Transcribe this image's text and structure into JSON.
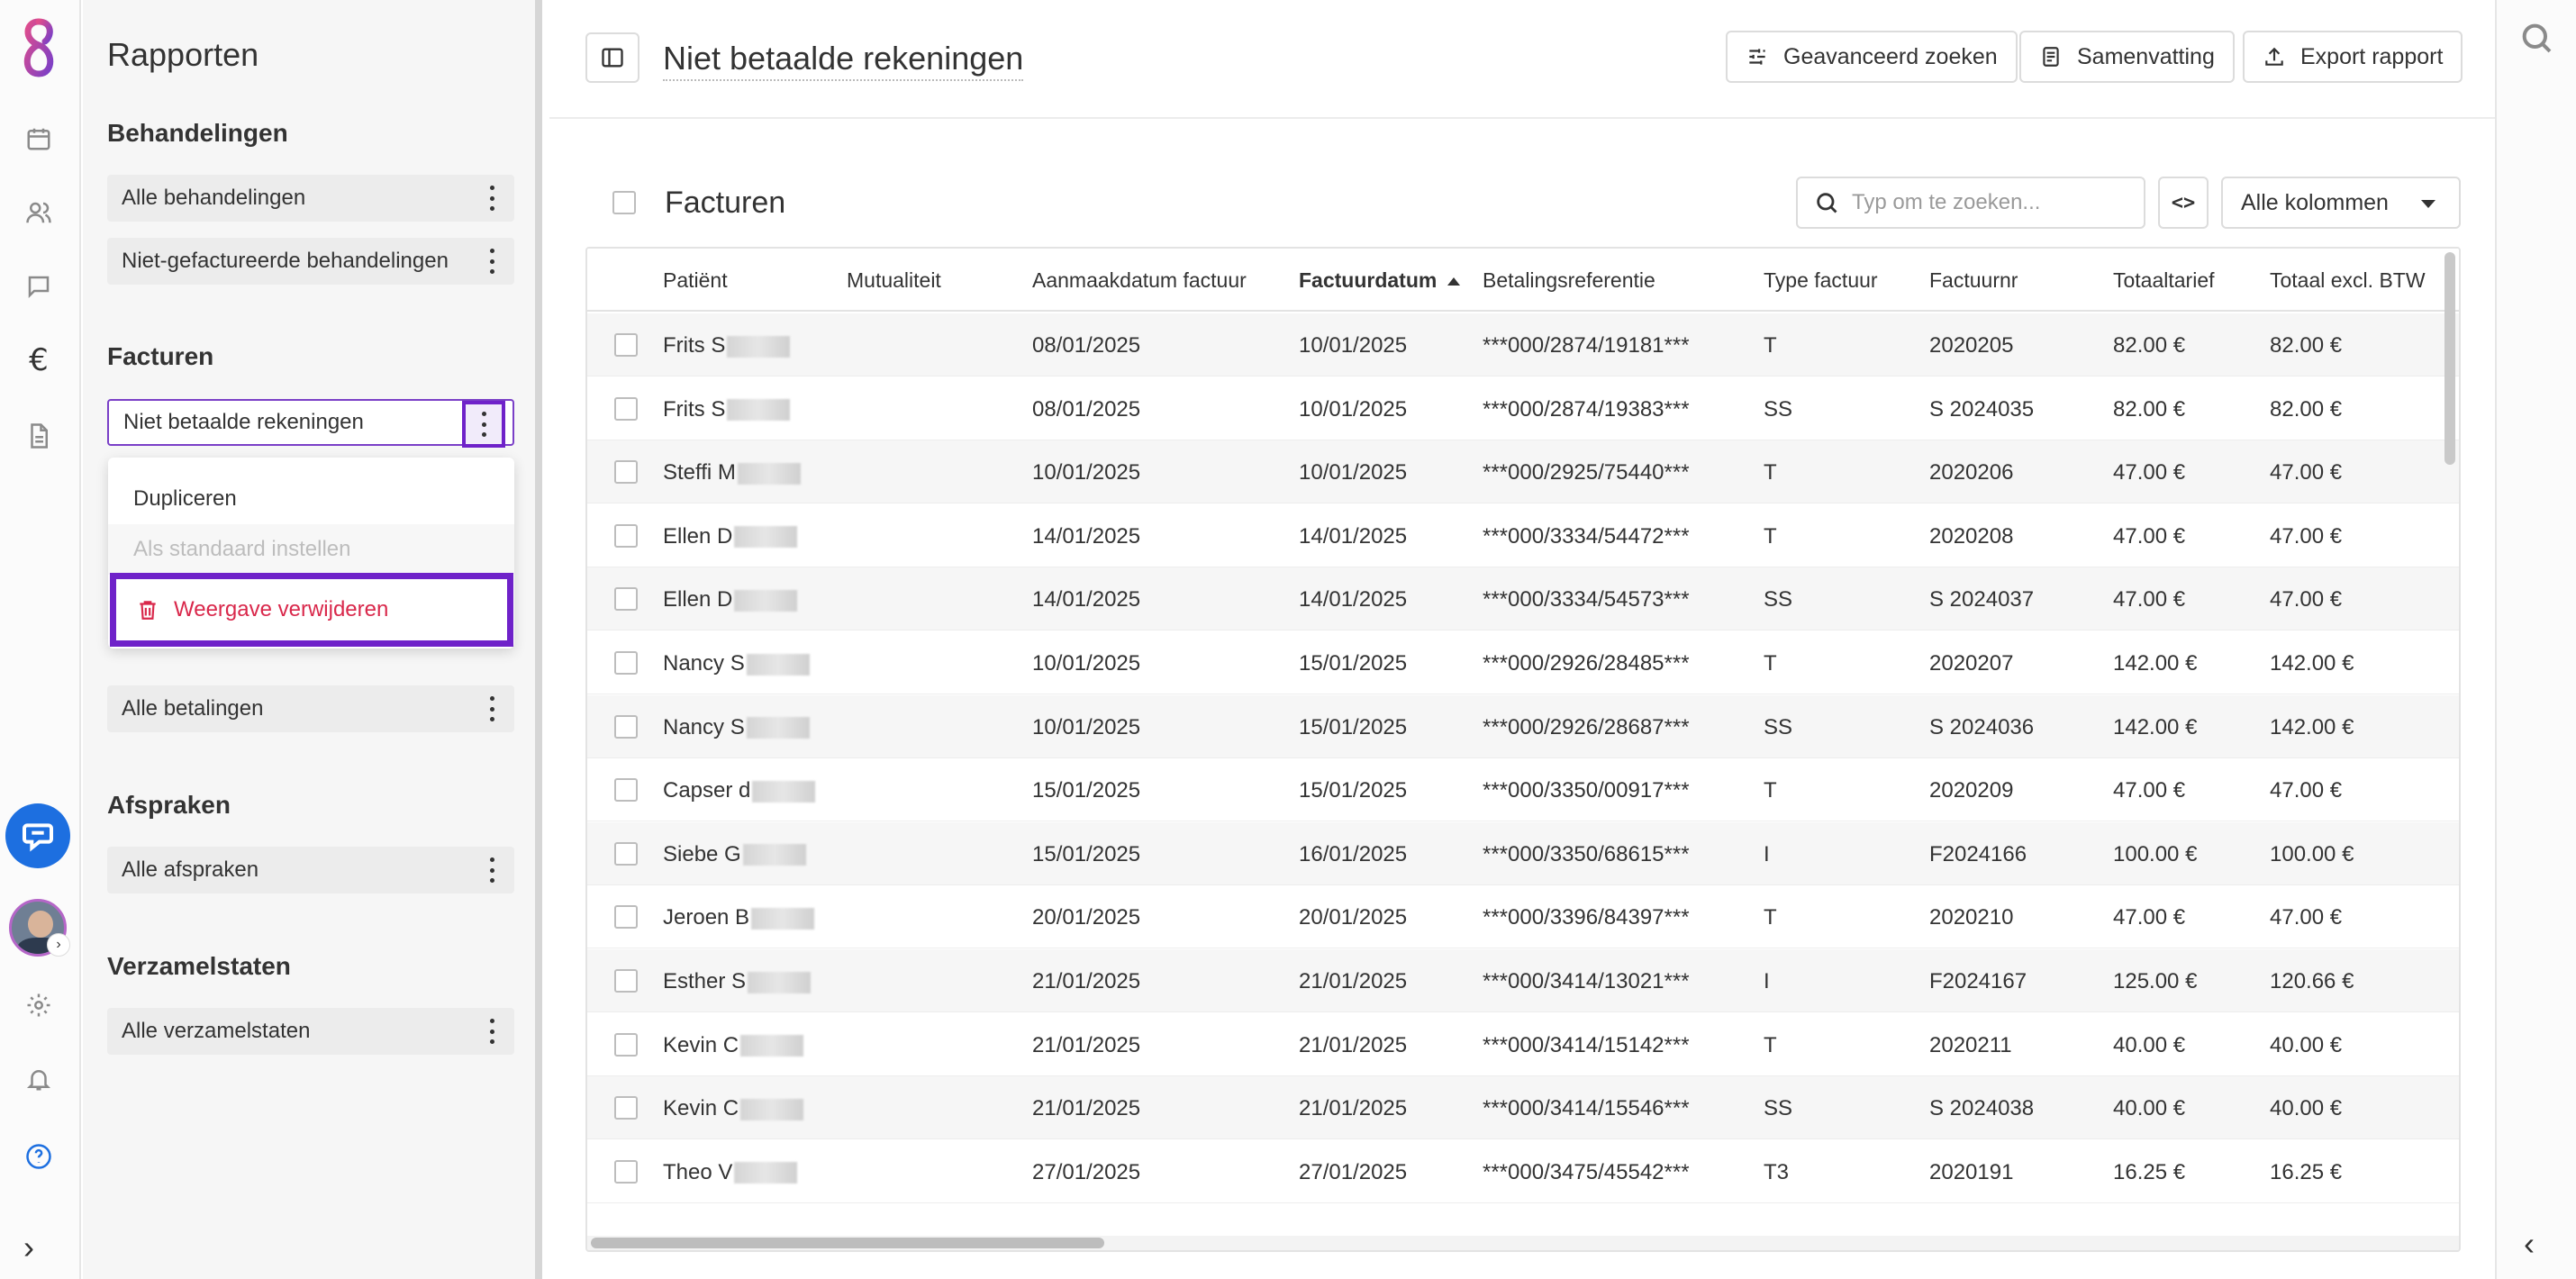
{
  "sidebar_reports": {
    "title": "Rapporten",
    "sections": {
      "behandelingen": {
        "heading": "Behandelingen",
        "items": [
          "Alle behandelingen",
          "Niet-gefactureerde behandelingen"
        ]
      },
      "facturen": {
        "heading": "Facturen",
        "items": [
          "Niet betaalde rekeningen"
        ]
      },
      "betalingen": {
        "items": [
          "Alle betalingen"
        ]
      },
      "afspraken": {
        "heading": "Afspraken",
        "items": [
          "Alle afspraken"
        ]
      },
      "verzamelstaten": {
        "heading": "Verzamelstaten",
        "items": [
          "Alle verzamelstaten"
        ]
      }
    }
  },
  "context_menu": {
    "duplicate": "Dupliceren",
    "set_default": "Als standaard instellen",
    "delete_view": "Weergave verwijderen"
  },
  "header": {
    "title": "Niet betaalde rekeningen",
    "advanced_search": "Geavanceerd zoeken",
    "summary": "Samenvatting",
    "export": "Export rapport"
  },
  "table_card": {
    "title": "Facturen",
    "search_placeholder": "Typ om te zoeken...",
    "code_toggle": "<>",
    "columns_select": "Alle kolommen"
  },
  "table": {
    "columns": [
      "Patiënt",
      "Mutualiteit",
      "Aanmaakdatum factuur",
      "Factuurdatum",
      "Betalingsreferentie",
      "Type factuur",
      "Factuurnr",
      "Totaaltarief",
      "Totaal excl. BTW"
    ],
    "sorted_column": "Factuurdatum",
    "rows": [
      [
        "Frits S",
        "",
        "08/01/2025",
        "10/01/2025",
        "***000/2874/19181***",
        "T",
        "2020205",
        "82.00 €",
        "82.00 €"
      ],
      [
        "Frits S",
        "",
        "08/01/2025",
        "10/01/2025",
        "***000/2874/19383***",
        "SS",
        "S 2024035",
        "82.00 €",
        "82.00 €"
      ],
      [
        "Steffi M",
        "",
        "10/01/2025",
        "10/01/2025",
        "***000/2925/75440***",
        "T",
        "2020206",
        "47.00 €",
        "47.00 €"
      ],
      [
        "Ellen D",
        "",
        "14/01/2025",
        "14/01/2025",
        "***000/3334/54472***",
        "T",
        "2020208",
        "47.00 €",
        "47.00 €"
      ],
      [
        "Ellen D",
        "",
        "14/01/2025",
        "14/01/2025",
        "***000/3334/54573***",
        "SS",
        "S 2024037",
        "47.00 €",
        "47.00 €"
      ],
      [
        "Nancy S",
        "",
        "10/01/2025",
        "15/01/2025",
        "***000/2926/28485***",
        "T",
        "2020207",
        "142.00 €",
        "142.00 €"
      ],
      [
        "Nancy S",
        "",
        "10/01/2025",
        "15/01/2025",
        "***000/2926/28687***",
        "SS",
        "S 2024036",
        "142.00 €",
        "142.00 €"
      ],
      [
        "Capser d",
        "",
        "15/01/2025",
        "15/01/2025",
        "***000/3350/00917***",
        "T",
        "2020209",
        "47.00 €",
        "47.00 €"
      ],
      [
        "Siebe G",
        "",
        "15/01/2025",
        "16/01/2025",
        "***000/3350/68615***",
        "I",
        "F2024166",
        "100.00 €",
        "100.00 €"
      ],
      [
        "Jeroen B",
        "",
        "20/01/2025",
        "20/01/2025",
        "***000/3396/84397***",
        "T",
        "2020210",
        "47.00 €",
        "47.00 €"
      ],
      [
        "Esther S",
        "",
        "21/01/2025",
        "21/01/2025",
        "***000/3414/13021***",
        "I",
        "F2024167",
        "125.00 €",
        "120.66 €"
      ],
      [
        "Kevin C",
        "",
        "21/01/2025",
        "21/01/2025",
        "***000/3414/15142***",
        "T",
        "2020211",
        "40.00 €",
        "40.00 €"
      ],
      [
        "Kevin C",
        "",
        "21/01/2025",
        "21/01/2025",
        "***000/3414/15546***",
        "SS",
        "S 2024038",
        "40.00 €",
        "40.00 €"
      ],
      [
        "Theo V",
        "",
        "27/01/2025",
        "27/01/2025",
        "***000/3475/45542***",
        "T3",
        "2020191",
        "16.25 €",
        "16.25 €"
      ]
    ]
  },
  "icons": {
    "rail": [
      "logo",
      "calendar-icon",
      "users-icon",
      "chat-icon",
      "euro-icon",
      "document-icon",
      "support-chat-icon",
      "avatar",
      "gear-icon",
      "bell-icon",
      "help-icon",
      "expand-icon"
    ],
    "right_rail": [
      "search-icon",
      "collapse-icon"
    ]
  },
  "colors": {
    "accent_purple": "#6f22c9",
    "danger_red": "#d9284b",
    "chat_blue": "#1d6fe0"
  }
}
